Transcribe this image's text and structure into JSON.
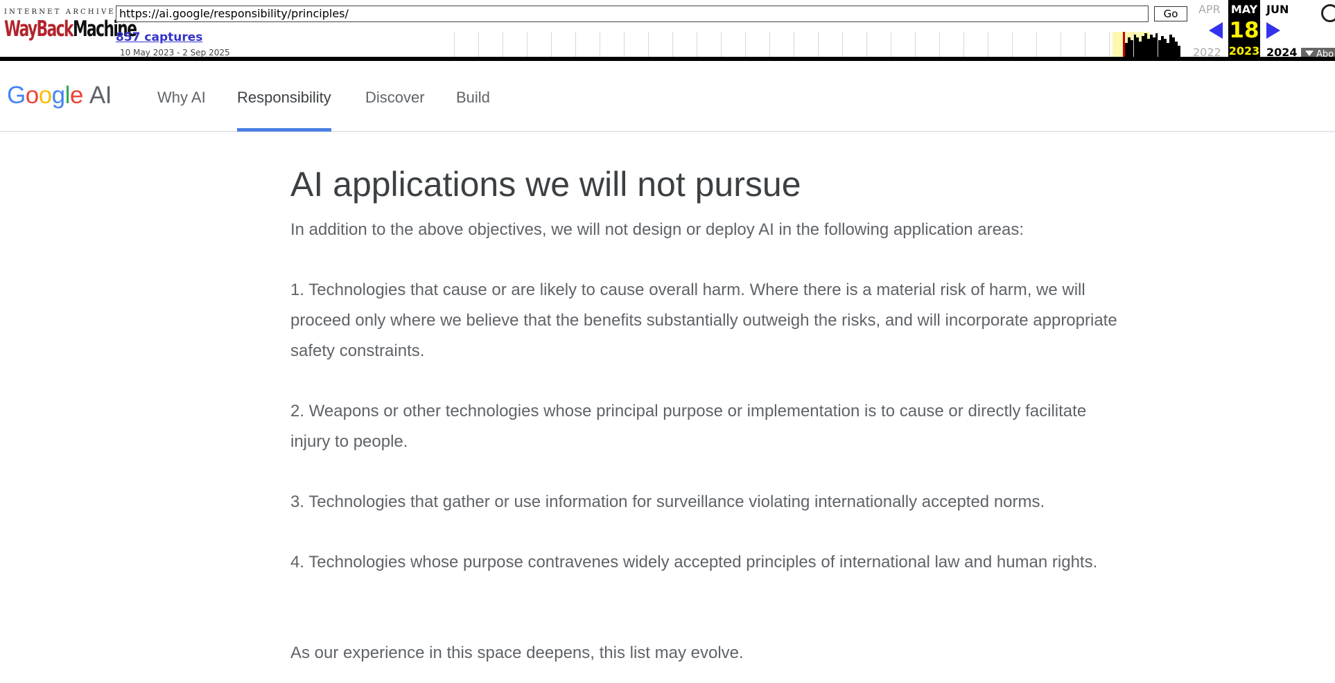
{
  "wayback": {
    "logo_top": "INTERNET ARCHIVE",
    "logo_wayback": "WayBack",
    "logo_machine": "Machine",
    "url": "https://ai.google/responsibility/principles/",
    "go_label": "Go",
    "captures_label": "857 captures",
    "date_range": "10 May 2023 - 2 Sep 2025",
    "prev_month": "APR",
    "current_month": "MAY",
    "next_month": "JUN",
    "current_day": "18",
    "prev_year": "2022",
    "current_year": "2023",
    "next_year": "2024",
    "about_label": "Abo",
    "colors": {
      "logo_red": "#b2242c",
      "captures_link": "#3333cc",
      "arrow": "#3333ee",
      "current_highlight": "#fff200"
    },
    "icons": [
      "left-arrow-icon",
      "right-arrow-icon",
      "dropdown-triangle-icon",
      "help-icon"
    ]
  },
  "site": {
    "logo": {
      "letters": [
        {
          "char": "G",
          "color": "#4285F4"
        },
        {
          "char": "o",
          "color": "#EA4335"
        },
        {
          "char": "o",
          "color": "#FBBC05"
        },
        {
          "char": "g",
          "color": "#4285F4"
        },
        {
          "char": "l",
          "color": "#34A853"
        },
        {
          "char": "e",
          "color": "#EA4335"
        }
      ],
      "suffix": "AI"
    },
    "nav": [
      {
        "label": "Why AI",
        "active": false
      },
      {
        "label": "Responsibility",
        "active": true
      },
      {
        "label": "Discover",
        "active": false
      },
      {
        "label": "Build",
        "active": false
      }
    ],
    "active_tab_color": "#4a7fe3"
  },
  "content": {
    "title": "AI applications we will not pursue",
    "intro": "In addition to the above objectives, we will not design or deploy AI in the following application areas:",
    "items": [
      "1. Technologies that cause or are likely to cause overall harm. Where there is a material risk of harm, we will proceed only where we believe that the benefits substantially outweigh the risks, and will incorporate appropriate safety constraints.",
      "2. Weapons or other technologies whose principal purpose or implementation is to cause or directly facilitate injury to people.",
      "3. Technologies that gather or use information for surveillance violating internationally accepted norms.",
      "4. Technologies whose purpose contravenes widely accepted principles of international law and human rights."
    ],
    "closing": "As our experience in this space deepens, this list may evolve."
  }
}
